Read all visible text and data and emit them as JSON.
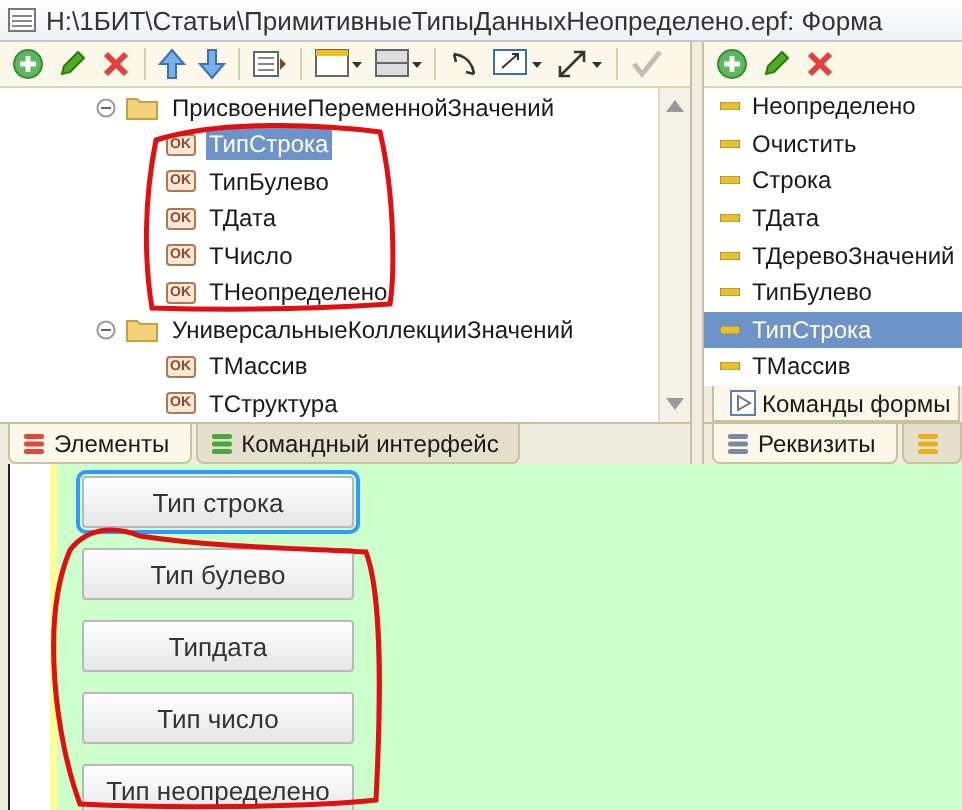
{
  "window": {
    "title": "H:\\1БИТ\\Статьи\\ПримитивныеТипыДанныхНеопределено.epf: Форма"
  },
  "tree": [
    {
      "label": "ПрисвоениеПеременнойЗначений",
      "expanded": true,
      "children": [
        {
          "label": "ТипСтрока",
          "badge": "OK",
          "selected": true
        },
        {
          "label": "ТипБулево",
          "badge": "OK",
          "selected": false
        },
        {
          "label": "ТДата",
          "badge": "OK",
          "selected": false
        },
        {
          "label": "ТЧисло",
          "badge": "OK",
          "selected": false
        },
        {
          "label": "ТНеопределено",
          "badge": "OK",
          "selected": false
        }
      ]
    },
    {
      "label": "УниверсальныеКоллекцииЗначений",
      "expanded": true,
      "children": [
        {
          "label": "ТМассив",
          "badge": "OK",
          "selected": false
        },
        {
          "label": "ТСтруктура",
          "badge": "OK",
          "selected": false
        }
      ]
    }
  ],
  "left_tabs": [
    {
      "label": "Элементы",
      "selected": true
    },
    {
      "label": "Командный интерфейс",
      "selected": false
    }
  ],
  "attributes": [
    {
      "label": "Неопределено",
      "selected": false
    },
    {
      "label": "Очистить",
      "selected": false
    },
    {
      "label": "Строка",
      "selected": false
    },
    {
      "label": "ТДата",
      "selected": false
    },
    {
      "label": "ТДеревоЗначений",
      "selected": false
    },
    {
      "label": "ТипБулево",
      "selected": false
    },
    {
      "label": "ТипСтрока",
      "selected": true
    },
    {
      "label": "ТМассив",
      "selected": false
    }
  ],
  "form_commands_tab": {
    "label": "Команды формы"
  },
  "right_tabs": [
    {
      "label": "Реквизиты",
      "selected": true
    }
  ],
  "form_buttons": [
    {
      "label": "Тип строка",
      "focused": true
    },
    {
      "label": "Тип булево",
      "focused": false
    },
    {
      "label": "Типдата",
      "focused": false
    },
    {
      "label": "Тип число",
      "focused": false
    },
    {
      "label": "Тип неопределено",
      "focused": false
    }
  ]
}
